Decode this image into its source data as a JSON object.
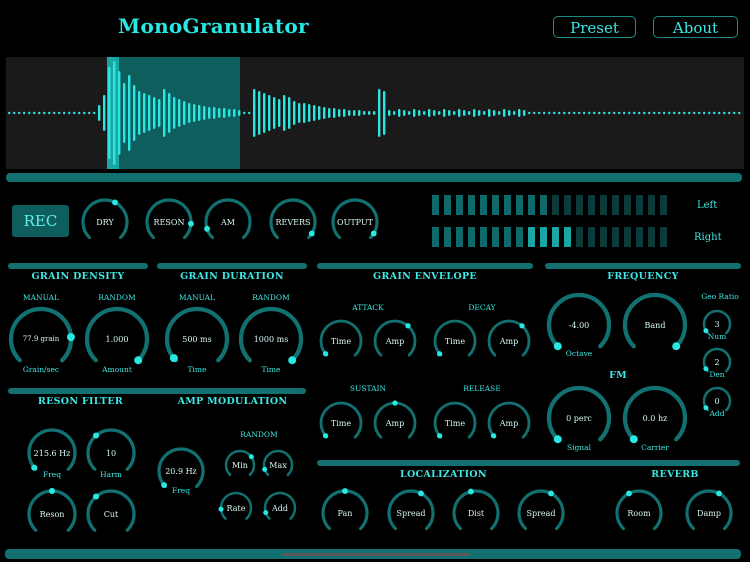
{
  "app": {
    "title": "MonoGranulator"
  },
  "header": {
    "preset_label": "Preset",
    "about_label": "About"
  },
  "transport": {
    "rec_label": "REC"
  },
  "mix_knobs": [
    {
      "label": "DRY",
      "value": 0.6
    },
    {
      "label": "RESON",
      "value": 0.85
    },
    {
      "label": "AM",
      "value": 0.1
    },
    {
      "label": "REVERS",
      "value": 0.95
    },
    {
      "label": "OUTPUT",
      "value": 0.95
    }
  ],
  "meters": {
    "left_label": "Left",
    "right_label": "Right",
    "left_level": 0.48,
    "right_level": 0.6
  },
  "grain_density": {
    "title": "GRAIN DENSITY",
    "manual_label": "MANUAL",
    "random_label": "RANDOM",
    "manual_value": "77.9 grain",
    "manual_caption": "Grain/sec",
    "random_value": "1.000",
    "random_caption": "Amount"
  },
  "grain_duration": {
    "title": "GRAIN DURATION",
    "manual_label": "MANUAL",
    "random_label": "RANDOM",
    "manual_value": "500 ms",
    "manual_caption": "Time",
    "random_value": "1000 ms",
    "random_caption": "Time"
  },
  "grain_envelope": {
    "title": "GRAIN ENVELOPE",
    "attack_label": "ATTACK",
    "decay_label": "DECAY",
    "sustain_label": "SUSTAIN",
    "release_label": "RELEASE",
    "time_label": "Time",
    "amp_label": "Amp"
  },
  "frequency": {
    "title": "FREQUENCY",
    "octave_value": "-4.00",
    "octave_caption": "Octave",
    "band_label": "Band",
    "geo_ratio_label": "Geo Ratio",
    "num_value": "3",
    "num_caption": "Num",
    "den_value": "2",
    "den_caption": "Den",
    "add_value": "0",
    "add_caption": "Add"
  },
  "fm": {
    "title": "FM",
    "signal_value": "0 perc",
    "signal_caption": "Signal",
    "carrier_value": "0.0 hz",
    "carrier_caption": "Carrier"
  },
  "reson_filter": {
    "title": "RESON FILTER",
    "freq_value": "215.6 Hz",
    "freq_caption": "Freq",
    "harm_value": "10",
    "harm_caption": "Harm",
    "reson_label": "Reson",
    "cut_label": "Cut"
  },
  "amp_modulation": {
    "title": "AMP MODULATION",
    "random_label": "RANDOM",
    "freq_value": "20.9 Hz",
    "freq_caption": "Freq",
    "min_label": "Min",
    "max_label": "Max",
    "rate_label": "Rate",
    "add_label": "Add"
  },
  "localization": {
    "title": "LOCALIZATION",
    "pan_label": "Pan",
    "spread_label": "Spread",
    "dist_label": "Dist",
    "spread2_label": "Spread"
  },
  "reverb": {
    "title": "REVERB",
    "room_label": "Room",
    "damp_label": "Damp"
  },
  "colors": {
    "accent": "#27e8e2",
    "track": "#127070",
    "background": "#000000",
    "waveform": "#2ee6e0",
    "selection": "#0e5e5e"
  }
}
